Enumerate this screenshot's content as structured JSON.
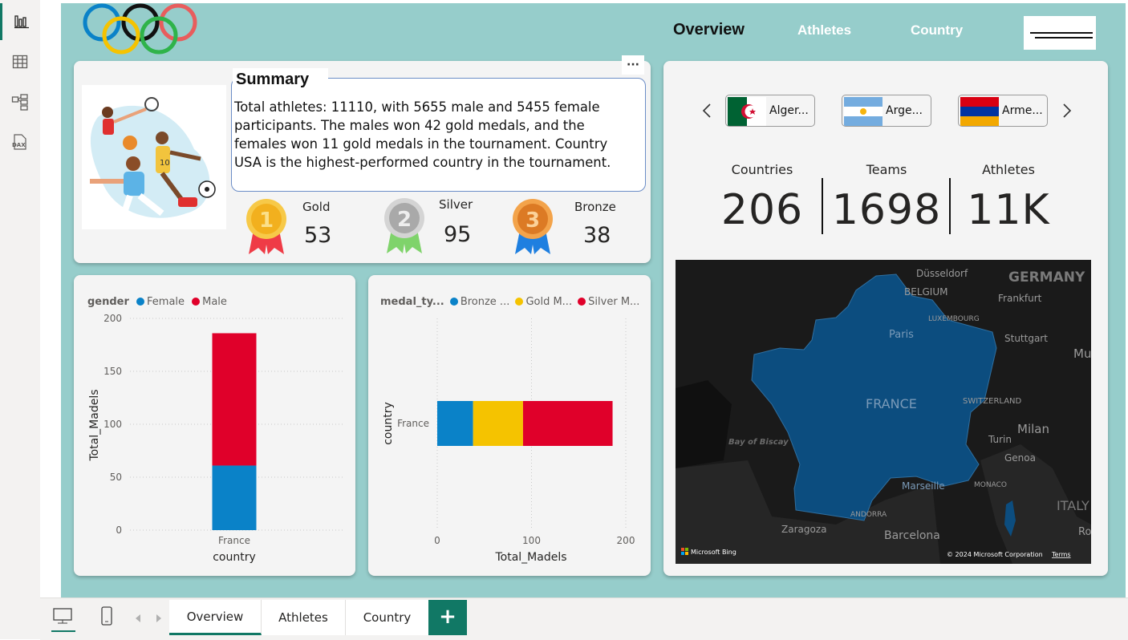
{
  "nav": {
    "overview": "Overview",
    "athletes": "Athletes",
    "country": "Country"
  },
  "summary": {
    "title": "Summary",
    "text": "Total athletes: 11110, with 5655 male and 5455 female participants. The males won 42 gold medals, and the females won 11 gold medals in the tournament. Country USA is the highest-performed country in the tournament.",
    "more_menu": "···"
  },
  "medals": {
    "gold": {
      "label": "Gold",
      "value": "53",
      "icon": "gold-medal-icon",
      "badge": "1"
    },
    "silver": {
      "label": "Silver",
      "value": "95",
      "icon": "silver-medal-icon",
      "badge": "2"
    },
    "bronze": {
      "label": "Bronze",
      "value": "38",
      "icon": "bronze-medal-icon",
      "badge": "3"
    }
  },
  "flags": [
    {
      "name": "Alger...",
      "icon": "algeria-flag-icon"
    },
    {
      "name": "Arge...",
      "icon": "argentina-flag-icon"
    },
    {
      "name": "Arme...",
      "icon": "armenia-flag-icon"
    }
  ],
  "kpis": [
    {
      "label": "Countries",
      "value": "206"
    },
    {
      "label": "Teams",
      "value": "1698"
    },
    {
      "label": "Athletes",
      "value": "11K"
    }
  ],
  "colors": {
    "canvas": "#96cdcb",
    "card": "#f4f4f4",
    "female": "#0a82c8",
    "male": "#e0002a",
    "bronze_series": "#0a82c8",
    "gold_series": "#f5c300",
    "silver_series": "#e0002a",
    "accent": "#117865",
    "map_france": "#0c4d7f"
  },
  "chart_data": [
    {
      "type": "bar",
      "stacked": true,
      "orientation": "vertical",
      "legend_title": "gender",
      "categories": [
        "France"
      ],
      "series": [
        {
          "name": "Female",
          "values": [
            61
          ]
        },
        {
          "name": "Male",
          "values": [
            125
          ]
        }
      ],
      "xlabel": "country",
      "ylabel": "Total_Madels",
      "ylim": [
        0,
        200
      ],
      "yticks": [
        "0",
        "50",
        "100",
        "150",
        "200"
      ],
      "grid": true,
      "legend_position": "top-left"
    },
    {
      "type": "bar",
      "stacked": true,
      "orientation": "horizontal",
      "legend_title": "medal_ty...",
      "categories": [
        "France"
      ],
      "series": [
        {
          "name": "Bronze ...",
          "values": [
            38
          ]
        },
        {
          "name": "Gold M...",
          "values": [
            53
          ]
        },
        {
          "name": "Silver M...",
          "values": [
            95
          ]
        }
      ],
      "xlabel": "Total_Madels",
      "ylabel": "country",
      "xlim": [
        0,
        200
      ],
      "xticks": [
        "0",
        "100",
        "200"
      ],
      "grid": true,
      "legend_position": "top-left"
    }
  ],
  "map": {
    "labels": {
      "germany": "GERMANY",
      "dusseldorf": "Düsseldorf",
      "belgium": "BELGIUM",
      "frankfurt": "Frankfurt",
      "luxembourg": "LUXEMBOURG",
      "stuttgart": "Stuttgart",
      "munich": "Muni",
      "paris": "Paris",
      "france": "FRANCE",
      "switzerland": "SWITZERLAND",
      "milan": "Milan",
      "turin": "Turin",
      "genoa": "Genoa",
      "bay_of_biscay": "Bay of Biscay",
      "marseille": "Marseille",
      "monaco": "MONACO",
      "andorra": "ANDORRA",
      "zaragoza": "Zaragoza",
      "barcelona": "Barcelona",
      "italy": "ITALY",
      "rome": "Ro"
    },
    "attribution": "Microsoft Bing",
    "copyright": "© 2024 Microsoft Corporation",
    "terms": "Terms"
  },
  "tabs": [
    "Overview",
    "Athletes",
    "Country"
  ],
  "add_tab": "+"
}
